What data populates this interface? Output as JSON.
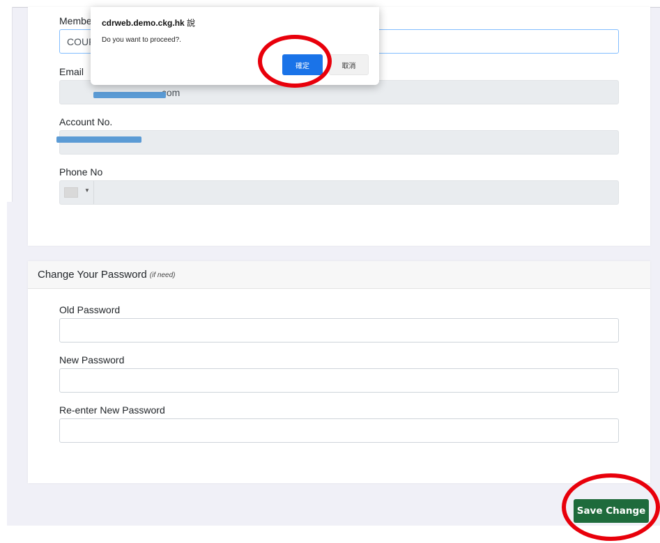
{
  "profile": {
    "member_label": "Member",
    "member_value": "COUPON",
    "email_label": "Email",
    "email_value_partial": ".com",
    "account_label": "Account No.",
    "phone_label": "Phone No"
  },
  "password_section": {
    "title": "Change Your Password",
    "hint": "(if need)",
    "old_label": "Old Password",
    "new_label": "New Password",
    "reenter_label": "Re-enter New Password"
  },
  "actions": {
    "save_label": "Save Change"
  },
  "dialog": {
    "host": "cdrweb.demo.ckg.hk",
    "says": "說",
    "message": "Do you want to proceed?.",
    "ok_label": "確定",
    "cancel_label": "取消"
  },
  "colors": {
    "save_button": "#1e6b3c",
    "dialog_ok": "#1a73e8",
    "highlight_ring": "#e8000b",
    "redaction": "#5b9bd5"
  }
}
